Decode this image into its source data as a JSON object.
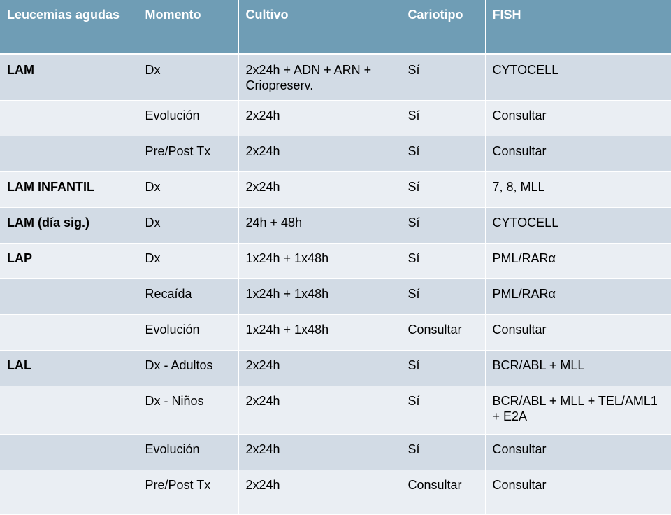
{
  "table": {
    "headers": [
      "Leucemias agudas",
      "Momento",
      "Cultivo",
      "Cariotipo",
      "FISH"
    ],
    "rows": [
      [
        "LAM",
        "Dx",
        "2x24h + ADN + ARN + Criopreserv.",
        "Sí",
        "CYTOCELL"
      ],
      [
        "",
        "Evolución",
        "2x24h",
        "Sí",
        "Consultar"
      ],
      [
        "",
        "Pre/Post Tx",
        "2x24h",
        "Sí",
        "Consultar"
      ],
      [
        "LAM INFANTIL",
        "Dx",
        "2x24h",
        "Sí",
        "7, 8, MLL"
      ],
      [
        "LAM (día sig.)",
        "Dx",
        "24h + 48h",
        "Sí",
        "CYTOCELL"
      ],
      [
        "LAP",
        "Dx",
        "1x24h + 1x48h",
        "Sí",
        "PML/RARα"
      ],
      [
        "",
        "Recaída",
        "1x24h + 1x48h",
        "Sí",
        "PML/RARα"
      ],
      [
        "",
        "Evolución",
        "1x24h + 1x48h",
        "Consultar",
        "Consultar"
      ],
      [
        "LAL",
        "Dx - Adultos",
        "2x24h",
        "Sí",
        "BCR/ABL + MLL"
      ],
      [
        "",
        "Dx - Niños",
        "2x24h",
        "Sí",
        "BCR/ABL + MLL + TEL/AML1 + E2A"
      ],
      [
        "",
        "Evolución",
        "2x24h",
        "Sí",
        "Consultar"
      ],
      [
        "",
        "Pre/Post Tx",
        "2x24h",
        "Consultar",
        "Consultar"
      ]
    ]
  },
  "colors": {
    "header_bg": "#6f9db5",
    "row_odd_bg": "#d2dbe5",
    "row_even_bg": "#eaeef3"
  }
}
